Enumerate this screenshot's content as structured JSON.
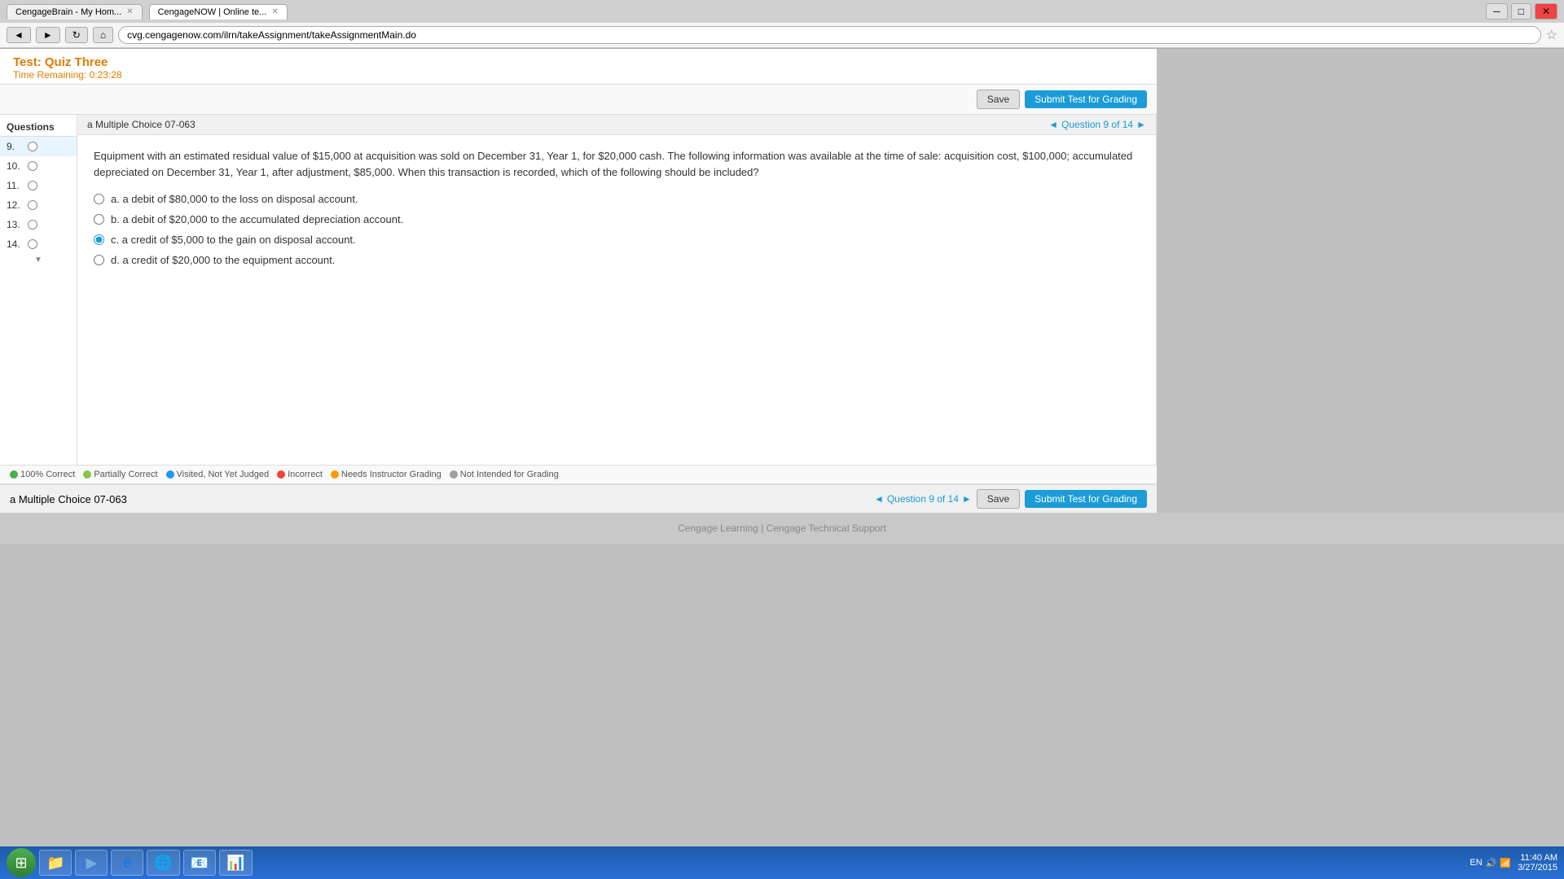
{
  "browser": {
    "tabs": [
      {
        "id": "tab1",
        "label": "CengageBrain - My Hom...",
        "active": false
      },
      {
        "id": "tab2",
        "label": "CengageNOW | Online te...",
        "active": true
      }
    ],
    "url": "cvg.cengagenow.com/ilrn/takeAssignment/takeAssignmentMain.do"
  },
  "test": {
    "title": "Test: Quiz Three",
    "time_label": "Time Remaining:",
    "time_value": "0:23:28"
  },
  "toolbar": {
    "save_label": "Save",
    "submit_label": "Submit Test for Grading"
  },
  "sidebar": {
    "header": "Questions",
    "items": [
      {
        "num": "9.",
        "answered": false
      },
      {
        "num": "10.",
        "answered": false
      },
      {
        "num": "11.",
        "answered": false
      },
      {
        "num": "12.",
        "answered": false
      },
      {
        "num": "13.",
        "answered": false
      },
      {
        "num": "14.",
        "answered": false
      }
    ]
  },
  "question": {
    "label": "a Multiple Choice 07-063",
    "nav_prev": "◄",
    "nav_text": "Question 9 of 14",
    "nav_next": "►",
    "body": "Equipment with an estimated residual value of $15,000 at acquisition was sold on December 31, Year 1, for $20,000 cash. The following information was available at the time of sale: acquisition cost, $100,000; accumulated depreciated on December 31, Year 1, after adjustment, $85,000. When this transaction is recorded, which of the following should be included?",
    "choices": [
      {
        "id": "a",
        "text": "a. a debit of $80,000 to the loss on disposal account.",
        "selected": false
      },
      {
        "id": "b",
        "text": "b. a debit of $20,000 to the accumulated depreciation account.",
        "selected": false
      },
      {
        "id": "c",
        "text": "c. a credit of $5,000 to the gain on disposal account.",
        "selected": true
      },
      {
        "id": "d",
        "text": "d. a credit of $20,000 to the equipment account.",
        "selected": false
      }
    ]
  },
  "legend": [
    {
      "label": "100% Correct",
      "color": "#4caf50"
    },
    {
      "label": "Partially Correct",
      "color": "#8bc34a"
    },
    {
      "label": "Visited, Not Yet Judged",
      "color": "#2196F3"
    },
    {
      "label": "Incorrect",
      "color": "#f44336"
    },
    {
      "label": "Needs Instructor Grading",
      "color": "#ff9800"
    },
    {
      "label": "Not Intended for Grading",
      "color": "#9e9e9e"
    }
  ],
  "bottom_toolbar": {
    "question_label": "a Multiple Choice 07-063",
    "nav_text": "Question 9 of 14",
    "save_label": "Save",
    "submit_label": "Submit Test for Grading"
  },
  "footer": {
    "cengage": "Cengage Learning",
    "separator": " | ",
    "support": "Cengage Technical Support"
  },
  "taskbar": {
    "time": "11:40 AM",
    "date": "3/27/2015"
  }
}
